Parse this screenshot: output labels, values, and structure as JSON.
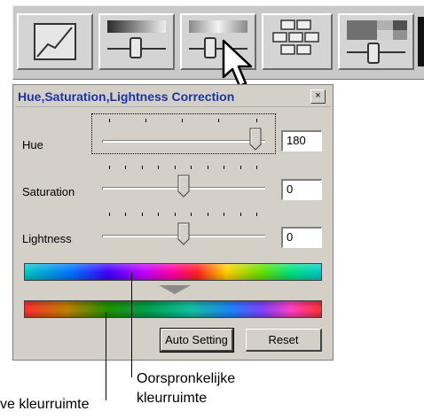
{
  "dialog": {
    "title": "Hue,Saturation,Lightness Correction",
    "close_label": "×",
    "sliders": [
      {
        "label": "Hue",
        "value": "180",
        "level": 1.0
      },
      {
        "label": "Saturation",
        "value": "0",
        "level": 0.5
      },
      {
        "label": "Lightness",
        "value": "0",
        "level": 0.5
      }
    ],
    "buttons": {
      "auto_setting": "Auto Setting",
      "reset": "Reset"
    }
  },
  "callouts": {
    "original_line1": "Oorspronkelijke",
    "original_line2": "kleurruimte",
    "new_partial": "ve kleurruimte"
  },
  "toolbar": {
    "icons": [
      "tone-curve-icon",
      "brightness-contrast-icon",
      "hue-saturation-icon",
      "color-palette-icon",
      "color-balance-icon"
    ]
  },
  "colors": {
    "title_text": "#1a35a8",
    "dialog_bg": "#d4d0c8"
  }
}
